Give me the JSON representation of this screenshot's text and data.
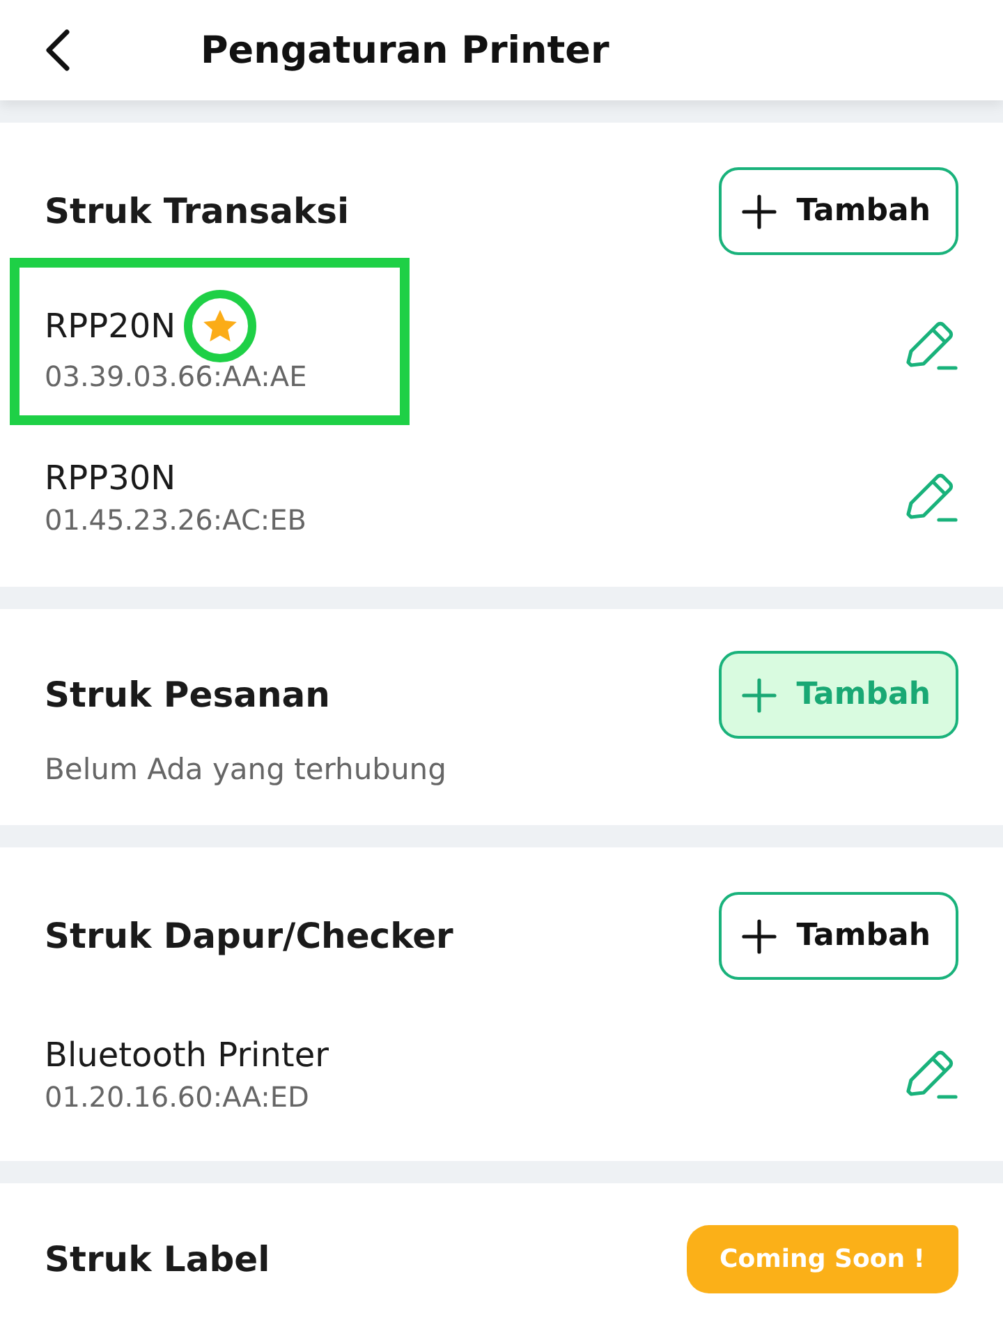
{
  "header": {
    "title": "Pengaturan Printer"
  },
  "sections": [
    {
      "title": "Struk Transaksi",
      "action": {
        "kind": "button",
        "label": "Tambah",
        "active": false
      },
      "printers": [
        {
          "name": "RPP20N",
          "address": "03.39.03.66:AA:AE",
          "default": true,
          "highlighted": true
        },
        {
          "name": "RPP30N",
          "address": "01.45.23.26:AC:EB",
          "default": false,
          "highlighted": false
        }
      ]
    },
    {
      "title": "Struk Pesanan",
      "subtitle": "Belum Ada yang terhubung",
      "action": {
        "kind": "button",
        "label": "Tambah",
        "active": true
      }
    },
    {
      "title": "Struk Dapur/Checker",
      "action": {
        "kind": "button",
        "label": "Tambah",
        "active": false
      },
      "printers": [
        {
          "name": "Bluetooth Printer",
          "address": "01.20.16.60:AA:ED",
          "default": false,
          "highlighted": false
        }
      ]
    },
    {
      "title": "Struk Label",
      "action": {
        "kind": "badge",
        "label": "Coming Soon !"
      }
    }
  ]
}
